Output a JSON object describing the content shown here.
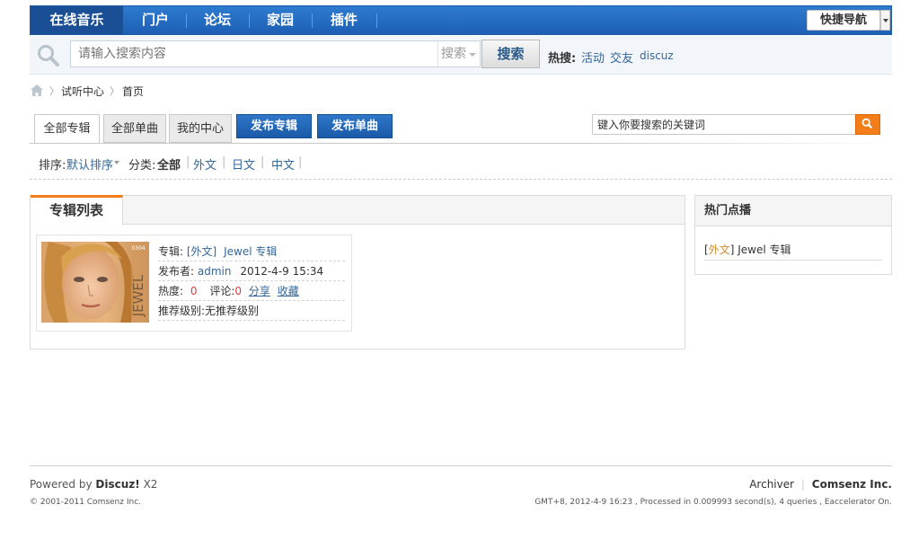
{
  "topnav": {
    "items": [
      "在线音乐",
      "门户",
      "论坛",
      "家园",
      "插件"
    ],
    "quicknav": "快捷导航"
  },
  "search": {
    "placeholder": "请输入搜索内容",
    "type_label": "搜索",
    "button": "搜索",
    "hot_label": "热搜:",
    "hot_links": [
      "活动",
      "交友",
      "discuz"
    ]
  },
  "breadcrumb": {
    "items": [
      "试听中心",
      "首页"
    ]
  },
  "tabs": [
    "全部专辑",
    "全部单曲",
    "我的中心"
  ],
  "buttons": [
    "发布专辑",
    "发布单曲"
  ],
  "keyword_search": {
    "value": "键入你要搜索的关键词"
  },
  "filters": {
    "sort_label": "排序:",
    "sort_value": "默认排序",
    "category_label": "分类:",
    "categories": [
      "全部",
      "外文",
      "日文",
      "中文"
    ]
  },
  "album_list": {
    "title": "专辑列表",
    "album": {
      "cover_text": "JEWEL",
      "cover_badge": "0304",
      "album_label": "专辑:",
      "album_category": "[外文]",
      "album_name": "Jewel 专辑",
      "publisher_label": "发布者:",
      "publisher": "admin",
      "date": "2012-4-9 15:34",
      "heat_label": "热度:",
      "heat": "0",
      "comment_label": "评论:",
      "comments": "0",
      "share": "分享",
      "favorite": "收藏",
      "recommend": "推荐级别:无推荐级别"
    }
  },
  "sidebar": {
    "title": "热门点播",
    "item_bracket_open": "[",
    "item_category": "外文",
    "item_bracket_close": "]",
    "item_name": " Jewel 专辑"
  },
  "footer": {
    "powered_by": "Powered by",
    "brand": "Discuz!",
    "version": "X2",
    "copyright": "© 2001-2011 Comsenz Inc.",
    "archiver": "Archiver",
    "company": "Comsenz Inc.",
    "stats": "GMT+8, 2012-4-9 16:23 , Processed in 0.009993 second(s), 4 queries , Eaccelerator On."
  },
  "colors": {
    "nav_blue": "#1d5fb4",
    "accent_orange": "#f37d18",
    "link_blue": "#336699",
    "red": "#e03c3c"
  }
}
